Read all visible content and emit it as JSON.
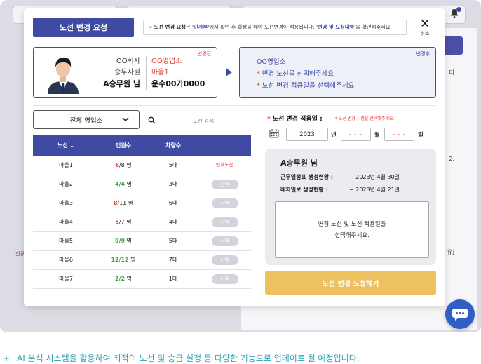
{
  "modal": {
    "title": "노선 변경 요청",
    "notice": {
      "ast": "*",
      "part1": "노선 변경 요청",
      "part2": "은 '",
      "part3": "인사부",
      "part4": "'에서 확인 후 확정을 해야 노선변경이 적용됩니다. '",
      "part5": "변경 및 요청내역",
      "part6": "'을 확인해주세요."
    },
    "close_label": "취소"
  },
  "before": {
    "tag": "변경전",
    "company": "OO회사",
    "role": "승무사원",
    "name": "A승무원 님",
    "office": "OO영업소",
    "route": "마을1",
    "vehicle": "운수00가0000"
  },
  "after": {
    "tag": "변경후",
    "office": "OO영업소",
    "line1": "변경 노선을 선택해주세요",
    "line2": "노선 변경 적용일을 선택해주세요",
    "ast": "*"
  },
  "filter": {
    "office_select": "전체 영업소",
    "search_placeholder": "노선 검색"
  },
  "table": {
    "headers": [
      "노선",
      "인원수",
      "차량수",
      ""
    ],
    "sort_indicator": "⌄",
    "rows": [
      {
        "route": "마을1",
        "cur": "6",
        "total": "/8",
        "unit": "명",
        "color": "red",
        "vehicles": "5대",
        "action": "현재노선",
        "is_current": true
      },
      {
        "route": "마을2",
        "cur": "4/4",
        "total": "",
        "unit": "명",
        "color": "green",
        "vehicles": "3대",
        "action": "선택",
        "is_current": false
      },
      {
        "route": "마을3",
        "cur": "8",
        "total": "/11",
        "unit": "명",
        "color": "red",
        "vehicles": "6대",
        "action": "선택",
        "is_current": false
      },
      {
        "route": "마을4",
        "cur": "5",
        "total": "/7",
        "unit": "명",
        "color": "red",
        "vehicles": "4대",
        "action": "선택",
        "is_current": false
      },
      {
        "route": "마을5",
        "cur": "9/9",
        "total": "",
        "unit": "명",
        "color": "green",
        "vehicles": "5대",
        "action": "선택",
        "is_current": false
      },
      {
        "route": "마을6",
        "cur": "12/12",
        "total": "",
        "unit": "명",
        "color": "green",
        "vehicles": "7대",
        "action": "선택",
        "is_current": false
      },
      {
        "route": "마을7",
        "cur": "2/2",
        "total": "",
        "unit": "명",
        "color": "green",
        "vehicles": "1대",
        "action": "선택",
        "is_current": false
      }
    ]
  },
  "date": {
    "ast": "*",
    "label": "노선 변경 적용일 :",
    "hint": "* 노선 변경 시점을 선택해주세요.",
    "year": "2023",
    "year_unit": "년",
    "month": "- - -",
    "month_unit": "월",
    "day": "- - -",
    "day_unit": "일"
  },
  "summary": {
    "name": "A승무원 님",
    "row1_key": "근무일정표 생성현황 :",
    "row1_val": "~ 2023년 4월 30일",
    "row2_key": "배차일보 생성현황 :",
    "row2_val": "~ 2023년 4월 21일",
    "msg_line1": "변경 노선 및 노선 적용일을",
    "msg_line2": "선택해주세요."
  },
  "submit_label": "노선 변경 요청하기",
  "background": {
    "right_text_1": "터",
    "right_text_2": "2.",
    "right_text_3": "유]",
    "left_text": "신규"
  },
  "footer": {
    "plus": "+",
    "text": "AI 분석 시스템을 활용하여 최적의 노선 및 승급 설정 등 다양한 기능으로 업데이트 될 예정입니다."
  },
  "colors": {
    "primary": "#3f4aa3",
    "accent_red": "#e53935",
    "accent_green": "#43a047",
    "submit": "#edc060",
    "footer_text": "#2ba1b5",
    "chat": "#2f5fc4"
  }
}
